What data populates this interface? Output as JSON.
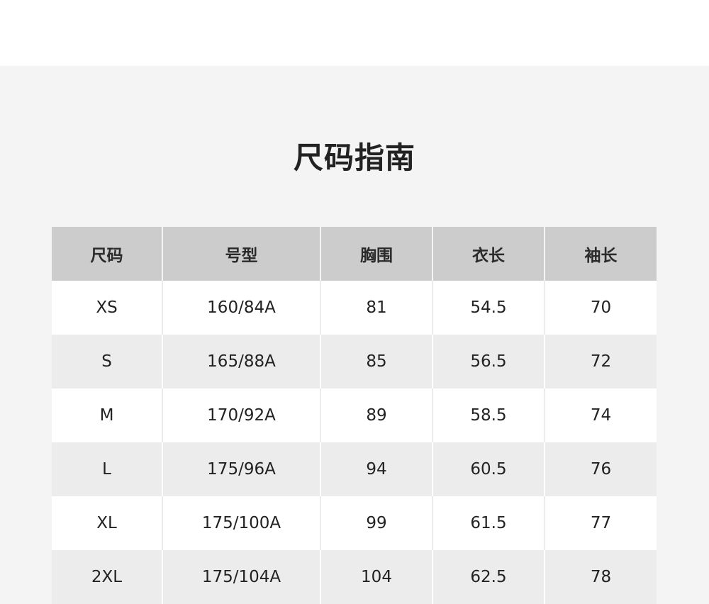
{
  "title": "尺码指南",
  "table": {
    "headers": [
      "尺码",
      "号型",
      "胸围",
      "衣长",
      "袖长"
    ],
    "rows": [
      [
        "XS",
        "160/84A",
        "81",
        "54.5",
        "70"
      ],
      [
        "S",
        "165/88A",
        "85",
        "56.5",
        "72"
      ],
      [
        "M",
        "170/92A",
        "89",
        "58.5",
        "74"
      ],
      [
        "L",
        "175/96A",
        "94",
        "60.5",
        "76"
      ],
      [
        "XL",
        "175/100A",
        "99",
        "61.5",
        "77"
      ],
      [
        "2XL",
        "175/104A",
        "104",
        "62.5",
        "78"
      ]
    ]
  }
}
